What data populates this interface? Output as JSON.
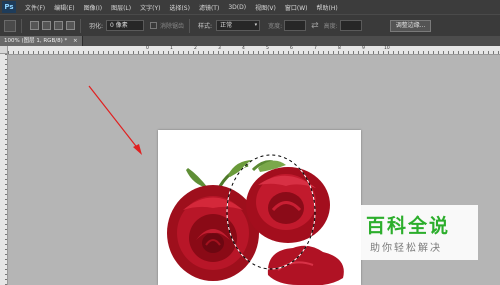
{
  "app": {
    "logo": "Ps"
  },
  "menu": [
    "文件(F)",
    "编辑(E)",
    "图像(I)",
    "图层(L)",
    "文字(Y)",
    "选择(S)",
    "滤镜(T)",
    "3D(D)",
    "视图(V)",
    "窗口(W)",
    "帮助(H)"
  ],
  "options": {
    "feather_label": "羽化:",
    "feather_value": "0 像素",
    "antialias_label": "消除锯齿",
    "style_label": "样式:",
    "style_value": "正常",
    "width_label": "宽度:",
    "height_label": "高度:",
    "swap_glyph": "⇄",
    "refine_button": "调整边缘..."
  },
  "document_tab": {
    "title": "100% (图层 1, RGB/8) *",
    "close": "×"
  },
  "ruler": {
    "numbers": [
      "0",
      "1",
      "2",
      "3",
      "4",
      "5",
      "6",
      "7",
      "8",
      "9",
      "10"
    ]
  },
  "watermark": {
    "title": "百科全说",
    "subtitle": "助你轻松解决"
  },
  "colors": {
    "menubar": "#3c3c3c",
    "workspace": "#b5b5b5",
    "annotation_arrow": "#e02020",
    "watermark_green": "#2cae2c"
  }
}
